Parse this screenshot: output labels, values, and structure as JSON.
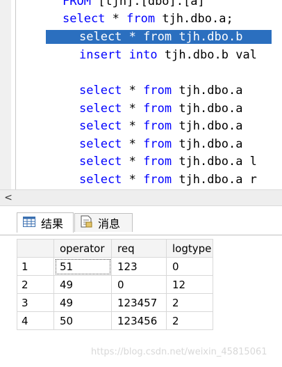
{
  "editor": {
    "lines": [
      {
        "kw1": "FROM ",
        "rest": "[tjh].[dbo].[a]"
      },
      {
        "kw1": "select",
        "mid": " * ",
        "kw2": "from",
        "rest": " tjh.dbo.a;"
      },
      {
        "kw1": "select",
        "mid": " * ",
        "kw2": "from",
        "rest": " tjh.dbo.b"
      },
      {
        "kw1": "insert",
        "mid": " ",
        "kw2": "into",
        "rest": " tjh.dbo.b val"
      },
      {
        "kw1": "select",
        "mid": " * ",
        "kw2": "from",
        "rest": " tjh.dbo.a"
      },
      {
        "kw1": "select",
        "mid": " * ",
        "kw2": "from",
        "rest": " tjh.dbo.a"
      },
      {
        "kw1": "select",
        "mid": " * ",
        "kw2": "from",
        "rest": " tjh.dbo.a"
      },
      {
        "kw1": "select",
        "mid": " * ",
        "kw2": "from",
        "rest": " tjh.dbo.a"
      },
      {
        "kw1": "select",
        "mid": " * ",
        "kw2": "from",
        "rest": " tjh.dbo.a l"
      },
      {
        "kw1": "select",
        "mid": " * ",
        "kw2": "from",
        "rest": " tjh.dbo.a r"
      }
    ]
  },
  "scrollbar": {
    "left_arrow": "<"
  },
  "tabs": {
    "results_label": "结果",
    "messages_label": "消息",
    "results_icon": "grid-icon",
    "messages_icon": "message-icon"
  },
  "grid": {
    "columns": [
      "operator",
      "req",
      "logtype"
    ],
    "rows": [
      {
        "num": "1",
        "operator": "51",
        "req": "123",
        "logtype": "0"
      },
      {
        "num": "2",
        "operator": "49",
        "req": "0",
        "logtype": "12"
      },
      {
        "num": "3",
        "operator": "49",
        "req": "123457",
        "logtype": "2"
      },
      {
        "num": "4",
        "operator": "50",
        "req": "123456",
        "logtype": "2"
      }
    ]
  },
  "watermark": "https://blog.csdn.net/weixin_45815061",
  "colors": {
    "keyword": "#0000ff",
    "selection": "#2b6fbf"
  }
}
